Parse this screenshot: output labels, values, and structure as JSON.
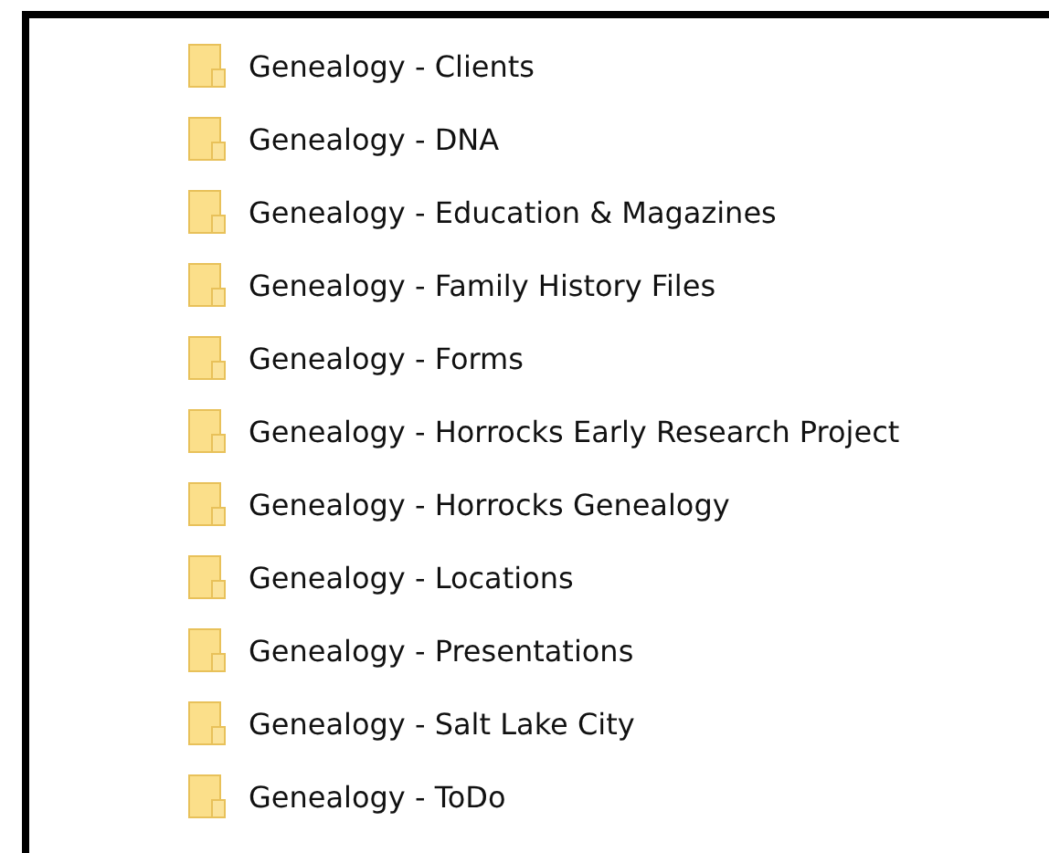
{
  "folders": [
    {
      "name": "Genealogy - Clients"
    },
    {
      "name": "Genealogy - DNA"
    },
    {
      "name": "Genealogy - Education & Magazines"
    },
    {
      "name": "Genealogy - Family History Files"
    },
    {
      "name": "Genealogy - Forms"
    },
    {
      "name": "Genealogy - Horrocks Early Research Project"
    },
    {
      "name": "Genealogy - Horrocks Genealogy"
    },
    {
      "name": "Genealogy - Locations"
    },
    {
      "name": "Genealogy - Presentations"
    },
    {
      "name": "Genealogy - Salt Lake City"
    },
    {
      "name": "Genealogy - ToDo"
    }
  ]
}
